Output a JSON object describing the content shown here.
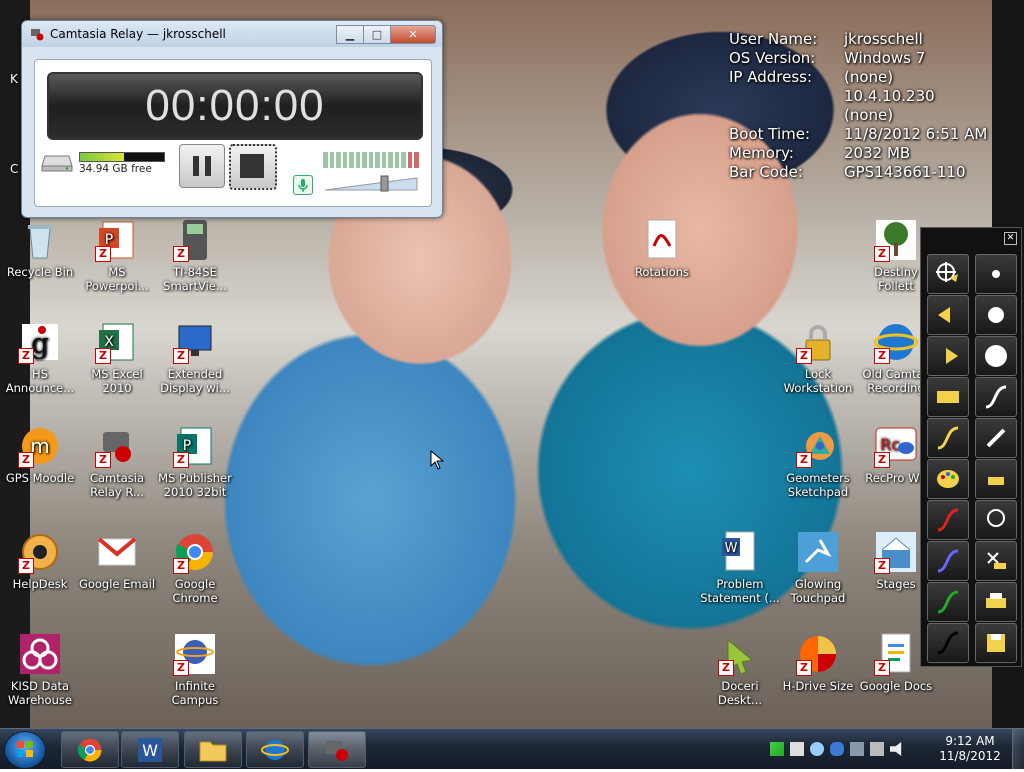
{
  "system_info": [
    {
      "label": "User Name:",
      "value": "jkrosschell"
    },
    {
      "label": "OS Version:",
      "value": "Windows 7"
    },
    {
      "label": "IP Address:",
      "value": "(none)"
    },
    {
      "label": "",
      "value": "10.4.10.230"
    },
    {
      "label": "",
      "value": "(none)"
    },
    {
      "label": "Boot Time:",
      "value": "11/8/2012 6:51 AM"
    },
    {
      "label": "Memory:",
      "value": "2032 MB"
    },
    {
      "label": "Bar Code:",
      "value": "GPS143661-110"
    }
  ],
  "relay": {
    "title": "Camtasia Relay — jkrosschell",
    "min": "▁",
    "max": "□",
    "close": "✕",
    "timer": "00:00:00",
    "disk_free": "34.94 GB free",
    "disk_used_fraction": 0.52
  },
  "icons": {
    "recycle": "Recycle Bin",
    "ppt": "MS Powerpoi...",
    "ti84": "TI-84SE SmartVie...",
    "rotations": "Rotations",
    "destiny": "Destiny Follett",
    "hs": "HS Announce...",
    "excel": "MS Excel 2010",
    "extended": "Extended Display wi...",
    "lock": "Lock Workstation",
    "oldcam": "Old Camtas Recording",
    "moodle": "GPS Moodle",
    "camrelay": "Camtasia Relay R...",
    "publisher": "MS Publisher 2010 32bit",
    "geometers": "Geometers Sketchpad",
    "recpro": "RecPro WE",
    "helpdesk": "HelpDesk",
    "gmail": "Google Email",
    "chrome": "Google Chrome",
    "problem": "Problem Statement (...",
    "glowing": "Glowing Touchpad",
    "stages": "Stages",
    "kisd": "KISD Data Warehouse",
    "infinite": "Infinite Campus",
    "doceri": "Doceri Deskt...",
    "hdrive": "H-Drive Size",
    "gdocs": "Google Docs",
    "partial_k": "K",
    "partial_c": "C"
  },
  "taskbar": {
    "time": "9:12 AM",
    "date": "11/8/2012"
  }
}
